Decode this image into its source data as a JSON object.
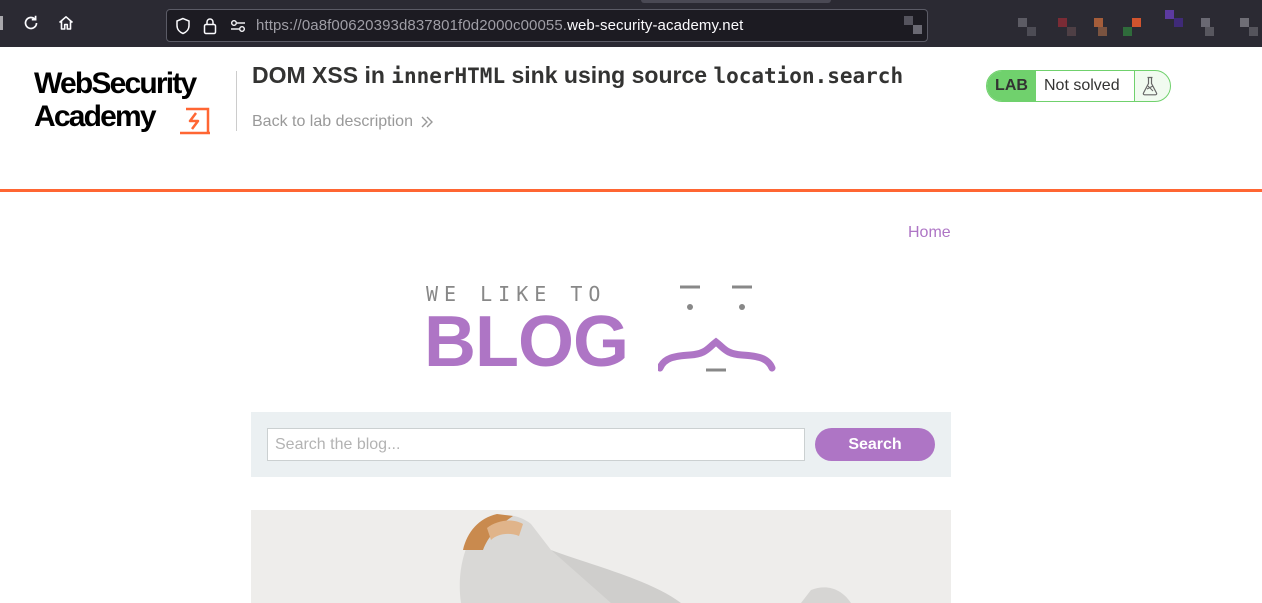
{
  "browser": {
    "url_prefix": "https://0a8f00620393d837801f0d2000c00055.",
    "url_domain": "web-security-academy.net",
    "icons": [
      "reload-icon",
      "home-icon",
      "shield-icon",
      "lock-icon",
      "permissions-icon"
    ]
  },
  "academy": {
    "logo_line1": "WebSecurity",
    "logo_line2": "Academy",
    "lab_title_pre": "DOM XSS in ",
    "lab_title_code1": "innerHTML",
    "lab_title_mid": " sink using source ",
    "lab_title_code2": "location.search",
    "back_link": "Back to lab description",
    "status_badge": "LAB",
    "status_text": "Not solved",
    "accent_color": "#ff6633",
    "status_color": "#70d16d"
  },
  "blog": {
    "home_link": "Home",
    "tagline": "WE LIKE TO",
    "wordmark": "BLOG",
    "search_placeholder": "Search the blog...",
    "search_button": "Search",
    "brand_color": "#ae75c5"
  }
}
